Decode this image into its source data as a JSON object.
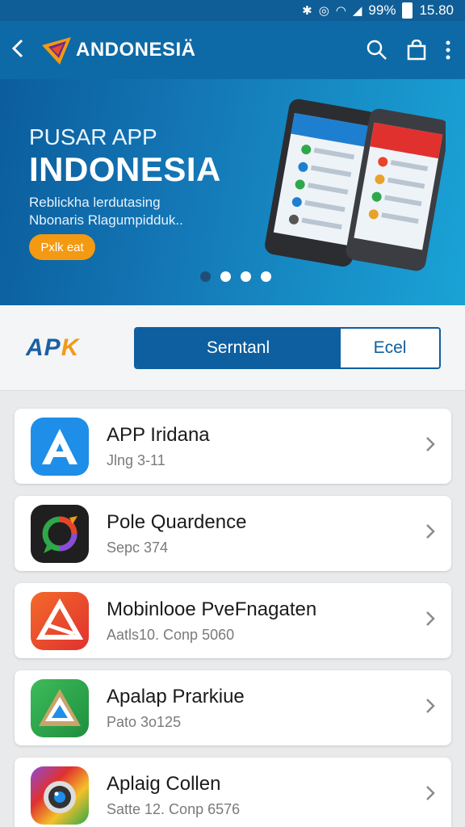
{
  "status_bar": {
    "battery": "99%",
    "time": "15.80"
  },
  "app_bar": {
    "title": "ANDONESIÄ",
    "back_icon": "back-chevron-icon",
    "actions": [
      "search-icon",
      "shopping-bag-icon",
      "more-vert-icon"
    ]
  },
  "hero": {
    "subtitle": "PUSAR APP",
    "title": "INDONESIA",
    "description_line1": "Reblickha lerdutasing",
    "description_line2": "Nbonaris Rlagumpidduk..",
    "button_label": "Pxlk eat",
    "carousel": {
      "count": 4,
      "active_index": 0
    }
  },
  "segment": {
    "logo": {
      "main": "AP",
      "accent": "K"
    },
    "options": [
      "Serntanl",
      "Ecel"
    ],
    "selected": "Serntanl"
  },
  "apps": [
    {
      "name": "APP Iridana",
      "meta": "Jlng 3-11",
      "icon": "app-store-a-icon",
      "color": "#1e8ee8"
    },
    {
      "name": "Pole Quardence",
      "meta": "Sepc 374",
      "icon": "chat-bubble-icon",
      "color": "#1f1f1f"
    },
    {
      "name": "Mobinlooe PveFnagaten",
      "meta": "Aatls10. Conp 5060",
      "icon": "triangle-ruler-icon",
      "color": "#e8432a"
    },
    {
      "name": "Apalap Prarkiue",
      "meta": "Pato 3o125",
      "icon": "triangle-map-icon",
      "color": "#2ea84a"
    },
    {
      "name": "Aplaig Collen",
      "meta": "Satte 12. Conp 6576",
      "icon": "camera-lens-icon",
      "color": "#8b4bd8"
    }
  ]
}
